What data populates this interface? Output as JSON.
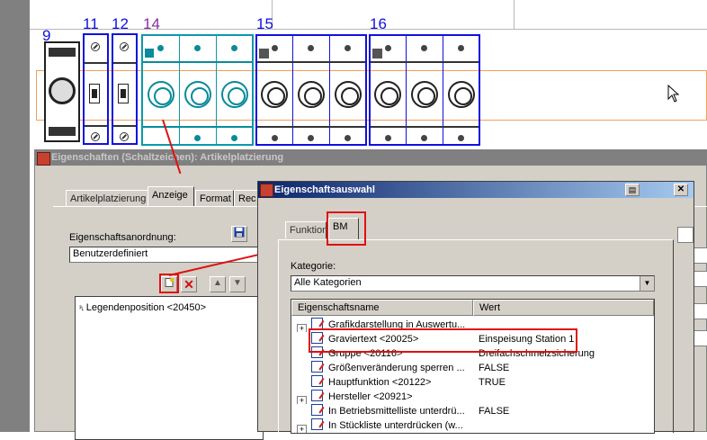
{
  "schematic": {
    "labels": [
      {
        "id": "9",
        "text": "9",
        "color": "#1010e0"
      },
      {
        "id": "11",
        "text": "11",
        "color": "#1010e0"
      },
      {
        "id": "12",
        "text": "12",
        "color": "#1010e0"
      },
      {
        "id": "14",
        "text": "14",
        "color": "#8a2ba0"
      },
      {
        "id": "15",
        "text": "15",
        "color": "#1010e0"
      },
      {
        "id": "16",
        "text": "16",
        "color": "#1010e0"
      }
    ]
  },
  "dialog_main": {
    "title": "Eigenschaften (Schaltzeichen): Artikelplatzierung",
    "tabs": [
      {
        "label": "Artikelplatzierung"
      },
      {
        "label": "Anzeige"
      },
      {
        "label": "Format"
      },
      {
        "label": "Rec"
      }
    ],
    "arrangement_label": "Eigenschaftsanordnung:",
    "arrangement_value": "Benutzerdefiniert",
    "list_items": [
      {
        "label": "Legendenposition <20450>"
      }
    ]
  },
  "dialog_select": {
    "title": "Eigenschaftsauswahl",
    "tabs": [
      {
        "label": "Funktion"
      },
      {
        "label": "BM"
      }
    ],
    "category_label": "Kategorie:",
    "category_value": "Alle Kategorien",
    "columns": {
      "name": "Eigenschaftsname",
      "value": "Wert"
    },
    "rows": [
      {
        "name": "Grafikdarstellung in Auswertu...",
        "value": "",
        "expandable": true
      },
      {
        "name": "Graviertext <20025>",
        "value": "Einspeisung Station 1",
        "expandable": false
      },
      {
        "name": "Gruppe <20116>",
        "value": "Dreifachschmelzsicherung",
        "expandable": false
      },
      {
        "name": "Größenveränderung sperren ...",
        "value": "FALSE",
        "expandable": false
      },
      {
        "name": "Hauptfunktion <20122>",
        "value": "TRUE",
        "expandable": false
      },
      {
        "name": "Hersteller <20921>",
        "value": "",
        "expandable": true
      },
      {
        "name": "In Betriebsmittelliste unterdrü...",
        "value": "FALSE",
        "expandable": false
      },
      {
        "name": "In Stückliste unterdrücken (w...",
        "value": "",
        "expandable": false
      }
    ]
  },
  "colors": {
    "accent_red": "#e01010",
    "title_active": "#0a246a",
    "module_blue": "#1010e0",
    "module_teal": "#0a9aaa"
  }
}
